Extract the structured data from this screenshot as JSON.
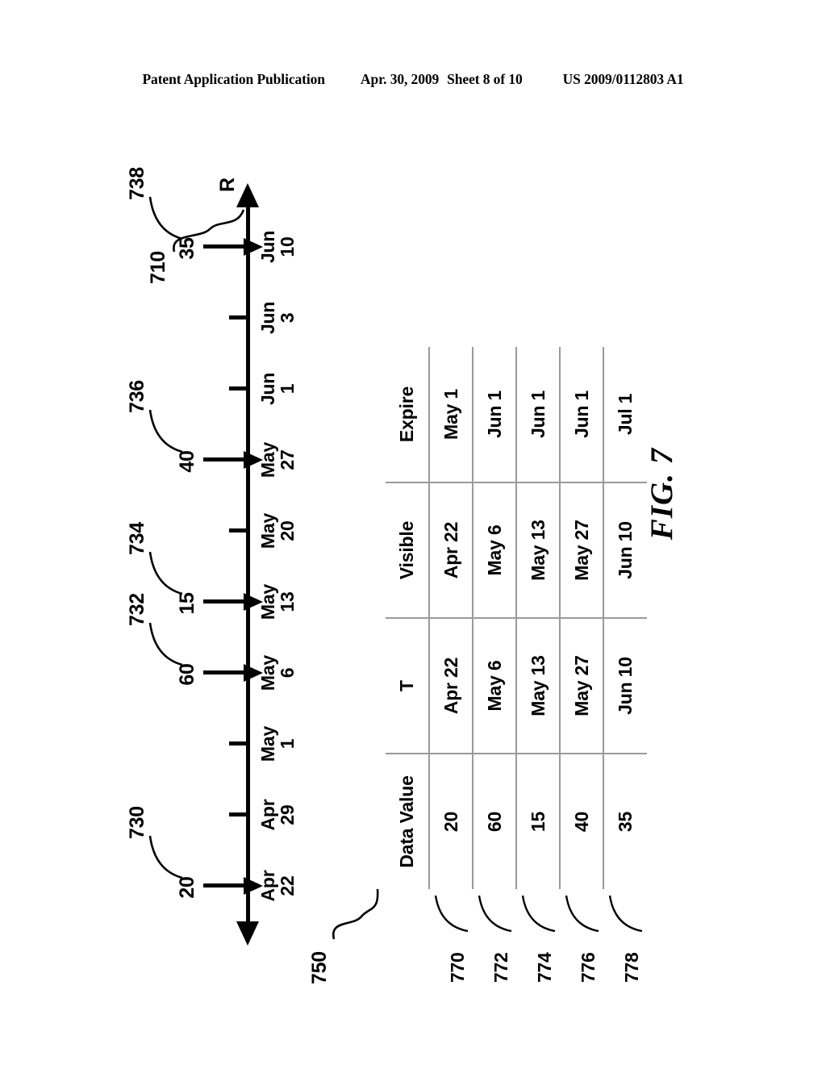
{
  "header": {
    "publication": "Patent Application Publication",
    "date": "Apr. 30, 2009",
    "sheet": "Sheet 8 of 10",
    "doc_number": "US 2009/0112803 A1"
  },
  "figure": {
    "caption": "FIG. 7",
    "axis": {
      "ref": "710",
      "name": "R",
      "ticks": [
        {
          "month": "Apr",
          "day": "22"
        },
        {
          "month": "Apr",
          "day": "29"
        },
        {
          "month": "May",
          "day": "1"
        },
        {
          "month": "May",
          "day": "6"
        },
        {
          "month": "May",
          "day": "13"
        },
        {
          "month": "May",
          "day": "20"
        },
        {
          "month": "May",
          "day": "27"
        },
        {
          "month": "Jun",
          "day": "1"
        },
        {
          "month": "Jun",
          "day": "3"
        },
        {
          "month": "Jun",
          "day": "10"
        }
      ]
    },
    "markers": [
      {
        "ref": "730",
        "value": "20",
        "tick_index": 0
      },
      {
        "ref": "732",
        "value": "60",
        "tick_index": 3
      },
      {
        "ref": "734",
        "value": "15",
        "tick_index": 4
      },
      {
        "ref": "736",
        "value": "40",
        "tick_index": 6
      },
      {
        "ref": "738",
        "value": "35",
        "tick_index": 9
      }
    ]
  },
  "table": {
    "ref": "750",
    "columns": [
      "Data Value",
      "T",
      "Visible",
      "Expire"
    ],
    "rows": [
      {
        "ref": "770",
        "data_value": "20",
        "t": "Apr 22",
        "visible": "Apr 22",
        "expire": "May 1"
      },
      {
        "ref": "772",
        "data_value": "60",
        "t": "May 6",
        "visible": "May 6",
        "expire": "Jun 1"
      },
      {
        "ref": "774",
        "data_value": "15",
        "t": "May 13",
        "visible": "May 13",
        "expire": "Jun 1"
      },
      {
        "ref": "776",
        "data_value": "40",
        "t": "May 27",
        "visible": "May 27",
        "expire": "Jun 1"
      },
      {
        "ref": "778",
        "data_value": "35",
        "t": "Jun 10",
        "visible": "Jun 10",
        "expire": "Jul 1"
      }
    ]
  }
}
